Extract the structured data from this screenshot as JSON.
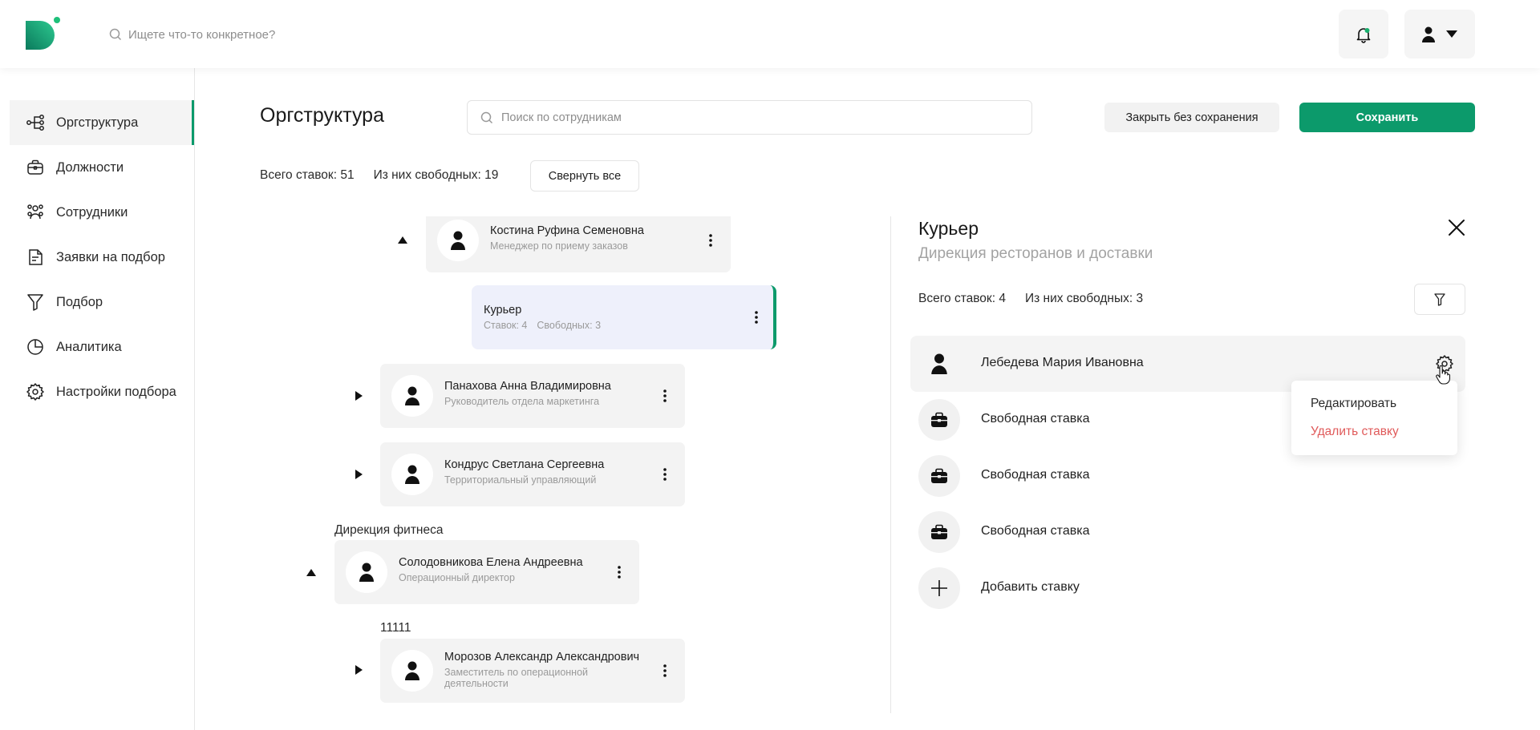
{
  "header": {
    "search_placeholder": "Ищете что-то конкретное?"
  },
  "sidebar": {
    "items": [
      {
        "label": "Оргструктура",
        "icon": "org-structure-icon",
        "active": true
      },
      {
        "label": "Должности",
        "icon": "briefcase-icon"
      },
      {
        "label": "Сотрудники",
        "icon": "people-icon"
      },
      {
        "label": "Заявки на подбор",
        "icon": "document-icon"
      },
      {
        "label": "Подбор",
        "icon": "funnel-icon"
      },
      {
        "label": "Аналитика",
        "icon": "pie-chart-icon"
      },
      {
        "label": "Настройки подбора",
        "icon": "gear-icon"
      }
    ]
  },
  "main": {
    "title": "Оргструктура",
    "search_placeholder": "Поиск по сотрудникам",
    "close_without_save": "Закрыть без сохранения",
    "save": "Сохранить",
    "stats": {
      "total": "Всего ставок: 51",
      "free": "Из них свободных: 19"
    },
    "collapse_all": "Свернуть все"
  },
  "tree": {
    "nodes": [
      {
        "name": "Костина Руфина Семеновна",
        "role": "Менеджер по приему заказов"
      },
      {
        "name": "Панахова Анна Владимировна",
        "role": "Руководитель отдела маркетинга"
      },
      {
        "name": "Кондрус Светлана Сергеевна",
        "role": "Территориальный управляющий"
      },
      {
        "name": "Солодовникова Елена Андреевна",
        "role": "Операционный директор"
      },
      {
        "name": "Морозов Александр Александрович",
        "role": "Заместитель по операционной деятельности"
      }
    ],
    "position": {
      "title": "Курьер",
      "slots": "Ставок: 4",
      "free": "Свободных: 3"
    },
    "groups": [
      "Дирекция фитнеса",
      "11111"
    ]
  },
  "panel": {
    "title": "Курьер",
    "subtitle": "Дирекция ресторанов и доставки",
    "total": "Всего ставок: 4",
    "free": "Из них свободных: 3",
    "slots": [
      {
        "label": "Лебедева Мария Ивановна",
        "type": "person"
      },
      {
        "label": "Свободная ставка",
        "type": "vacant"
      },
      {
        "label": "Свободная ставка",
        "type": "vacant"
      },
      {
        "label": "Свободная ставка",
        "type": "vacant"
      },
      {
        "label": "Добавить ставку",
        "type": "add"
      }
    ],
    "menu": {
      "edit": "Редактировать",
      "delete": "Удалить ставку"
    }
  },
  "colors": {
    "accent": "#0c9a6b",
    "danger": "#e05a5a",
    "position_bg": "#eef0fb"
  }
}
